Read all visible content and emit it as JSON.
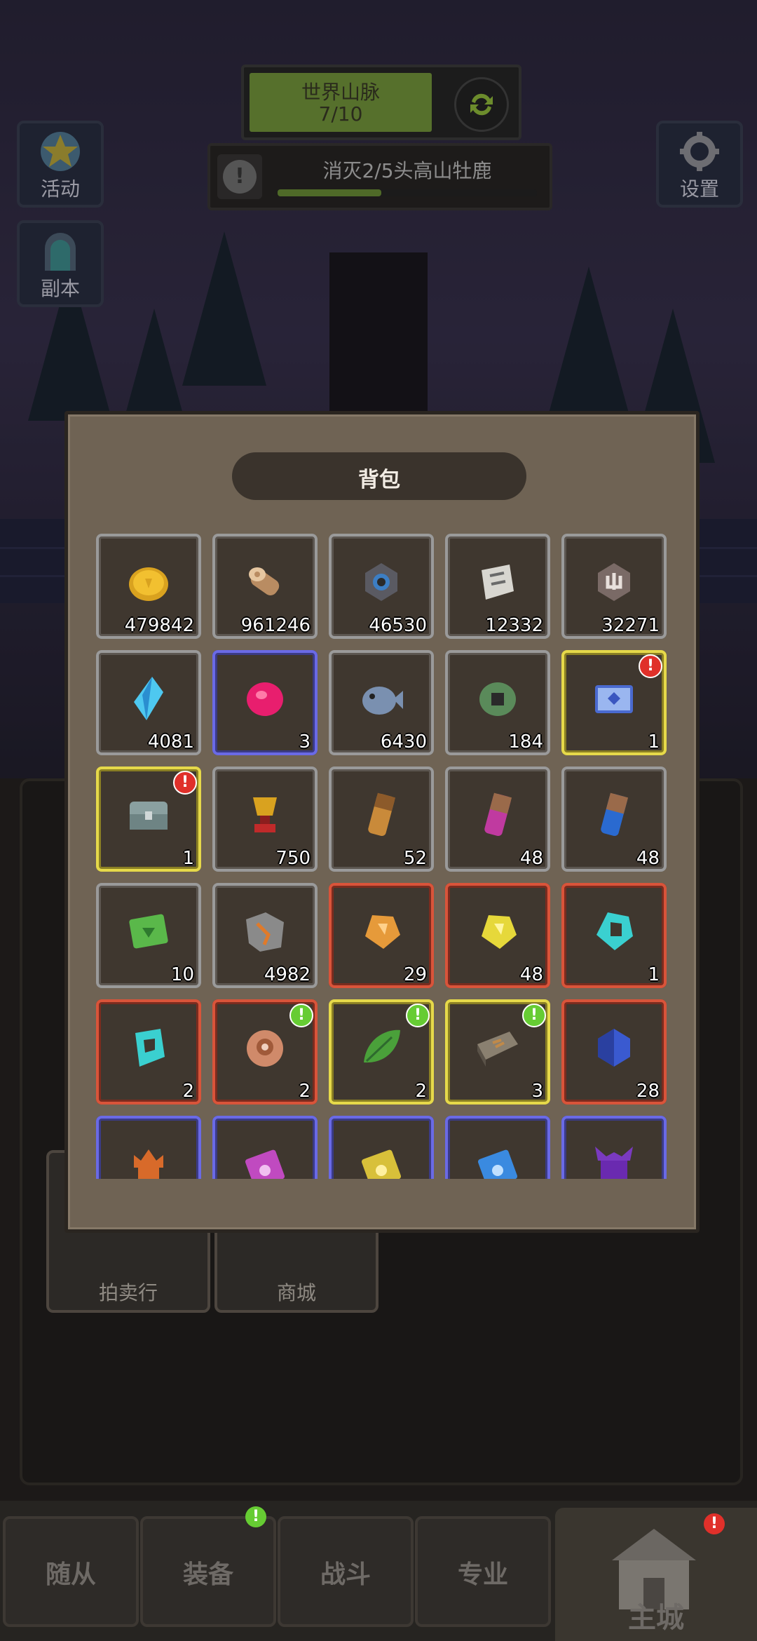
{
  "hud": {
    "region_name": "世界山脉",
    "region_progress": "7/10",
    "quest_text": "消灭2/5头高山牡鹿",
    "quest_progress": 0.4,
    "activity_label": "活动",
    "dungeon_label": "副本",
    "settings_label": "设置"
  },
  "background_tiles": {
    "auction_label": "拍卖行",
    "shop_label": "商城"
  },
  "bag": {
    "title": "背包",
    "items": [
      {
        "icon": "gold-coin-icon",
        "count": "479842",
        "rarity": "gray"
      },
      {
        "icon": "wood-log-icon",
        "count": "961246",
        "rarity": "gray"
      },
      {
        "icon": "blue-ore-icon",
        "count": "46530",
        "rarity": "gray"
      },
      {
        "icon": "scroll-icon",
        "count": "12332",
        "rarity": "gray"
      },
      {
        "icon": "stone-rune-icon",
        "count": "32271",
        "rarity": "gray"
      },
      {
        "icon": "blue-crystal-icon",
        "count": "4081",
        "rarity": "gray"
      },
      {
        "icon": "pink-gem-icon",
        "count": "3",
        "rarity": "blue"
      },
      {
        "icon": "fish-icon",
        "count": "6430",
        "rarity": "gray"
      },
      {
        "icon": "green-coin-icon",
        "count": "184",
        "rarity": "gray"
      },
      {
        "icon": "blue-chest-icon",
        "count": "1",
        "rarity": "gold",
        "badge": "red"
      },
      {
        "icon": "silver-chest-icon",
        "count": "1",
        "rarity": "gold",
        "badge": "red"
      },
      {
        "icon": "trophy-icon",
        "count": "750",
        "rarity": "gray"
      },
      {
        "icon": "orange-potion-icon",
        "count": "52",
        "rarity": "gray"
      },
      {
        "icon": "magenta-potion-icon",
        "count": "48",
        "rarity": "gray"
      },
      {
        "icon": "blue-potion-icon",
        "count": "48",
        "rarity": "gray"
      },
      {
        "icon": "green-ticket-icon",
        "count": "10",
        "rarity": "gray"
      },
      {
        "icon": "map-fragment-icon",
        "count": "4982",
        "rarity": "gray"
      },
      {
        "icon": "orange-shard-icon",
        "count": "29",
        "rarity": "red"
      },
      {
        "icon": "yellow-shard-icon",
        "count": "48",
        "rarity": "red"
      },
      {
        "icon": "cyan-ring-icon",
        "count": "1",
        "rarity": "red"
      },
      {
        "icon": "cyan-rune-icon",
        "count": "2",
        "rarity": "red"
      },
      {
        "icon": "copper-shell-icon",
        "count": "2",
        "rarity": "red",
        "badge": "green"
      },
      {
        "icon": "green-leaf-icon",
        "count": "2",
        "rarity": "gold",
        "badge": "green"
      },
      {
        "icon": "skill-book-icon",
        "count": "3",
        "rarity": "gold",
        "badge": "green"
      },
      {
        "icon": "blue-gem-icon",
        "count": "28",
        "rarity": "red"
      },
      {
        "icon": "orange-helmet-icon",
        "count": "",
        "rarity": "blue"
      },
      {
        "icon": "purple-card-icon",
        "count": "",
        "rarity": "blue"
      },
      {
        "icon": "yellow-card-icon",
        "count": "",
        "rarity": "blue"
      },
      {
        "icon": "blue-card-icon",
        "count": "",
        "rarity": "blue"
      },
      {
        "icon": "purple-helmet-icon",
        "count": "",
        "rarity": "blue"
      }
    ]
  },
  "nav": {
    "followers_label": "随从",
    "equipment_label": "装备",
    "battle_label": "战斗",
    "profession_label": "专业",
    "main_city_label": "主城"
  },
  "colors": {
    "rarity_gray": "#9a9a9a",
    "rarity_blue": "#6a6ae6",
    "rarity_gold": "#e6d94a",
    "rarity_red": "#d9543a",
    "badge_red": "#e0302a",
    "badge_green": "#66cc33",
    "region_green": "#56702c"
  }
}
